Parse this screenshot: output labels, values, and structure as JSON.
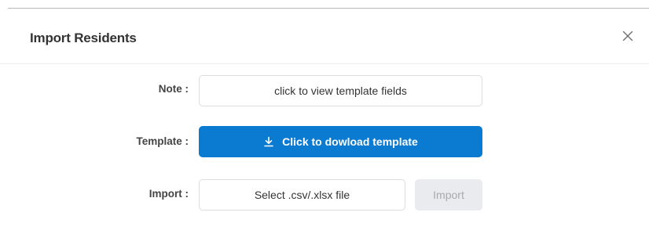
{
  "modal": {
    "title": "Import Residents",
    "close_icon": "close-icon"
  },
  "form": {
    "note": {
      "label": "Note :",
      "button_label": "click to view template fields"
    },
    "template": {
      "label": "Template :",
      "button_label": "Click to dowload template",
      "icon": "download-icon"
    },
    "import": {
      "label": "Import :",
      "file_button_label": "Select .csv/.xlsx file",
      "import_button_label": "Import"
    }
  },
  "colors": {
    "primary": "#0b7ad1",
    "disabled_bg": "#e9ebee",
    "disabled_text": "#a7abb1"
  }
}
